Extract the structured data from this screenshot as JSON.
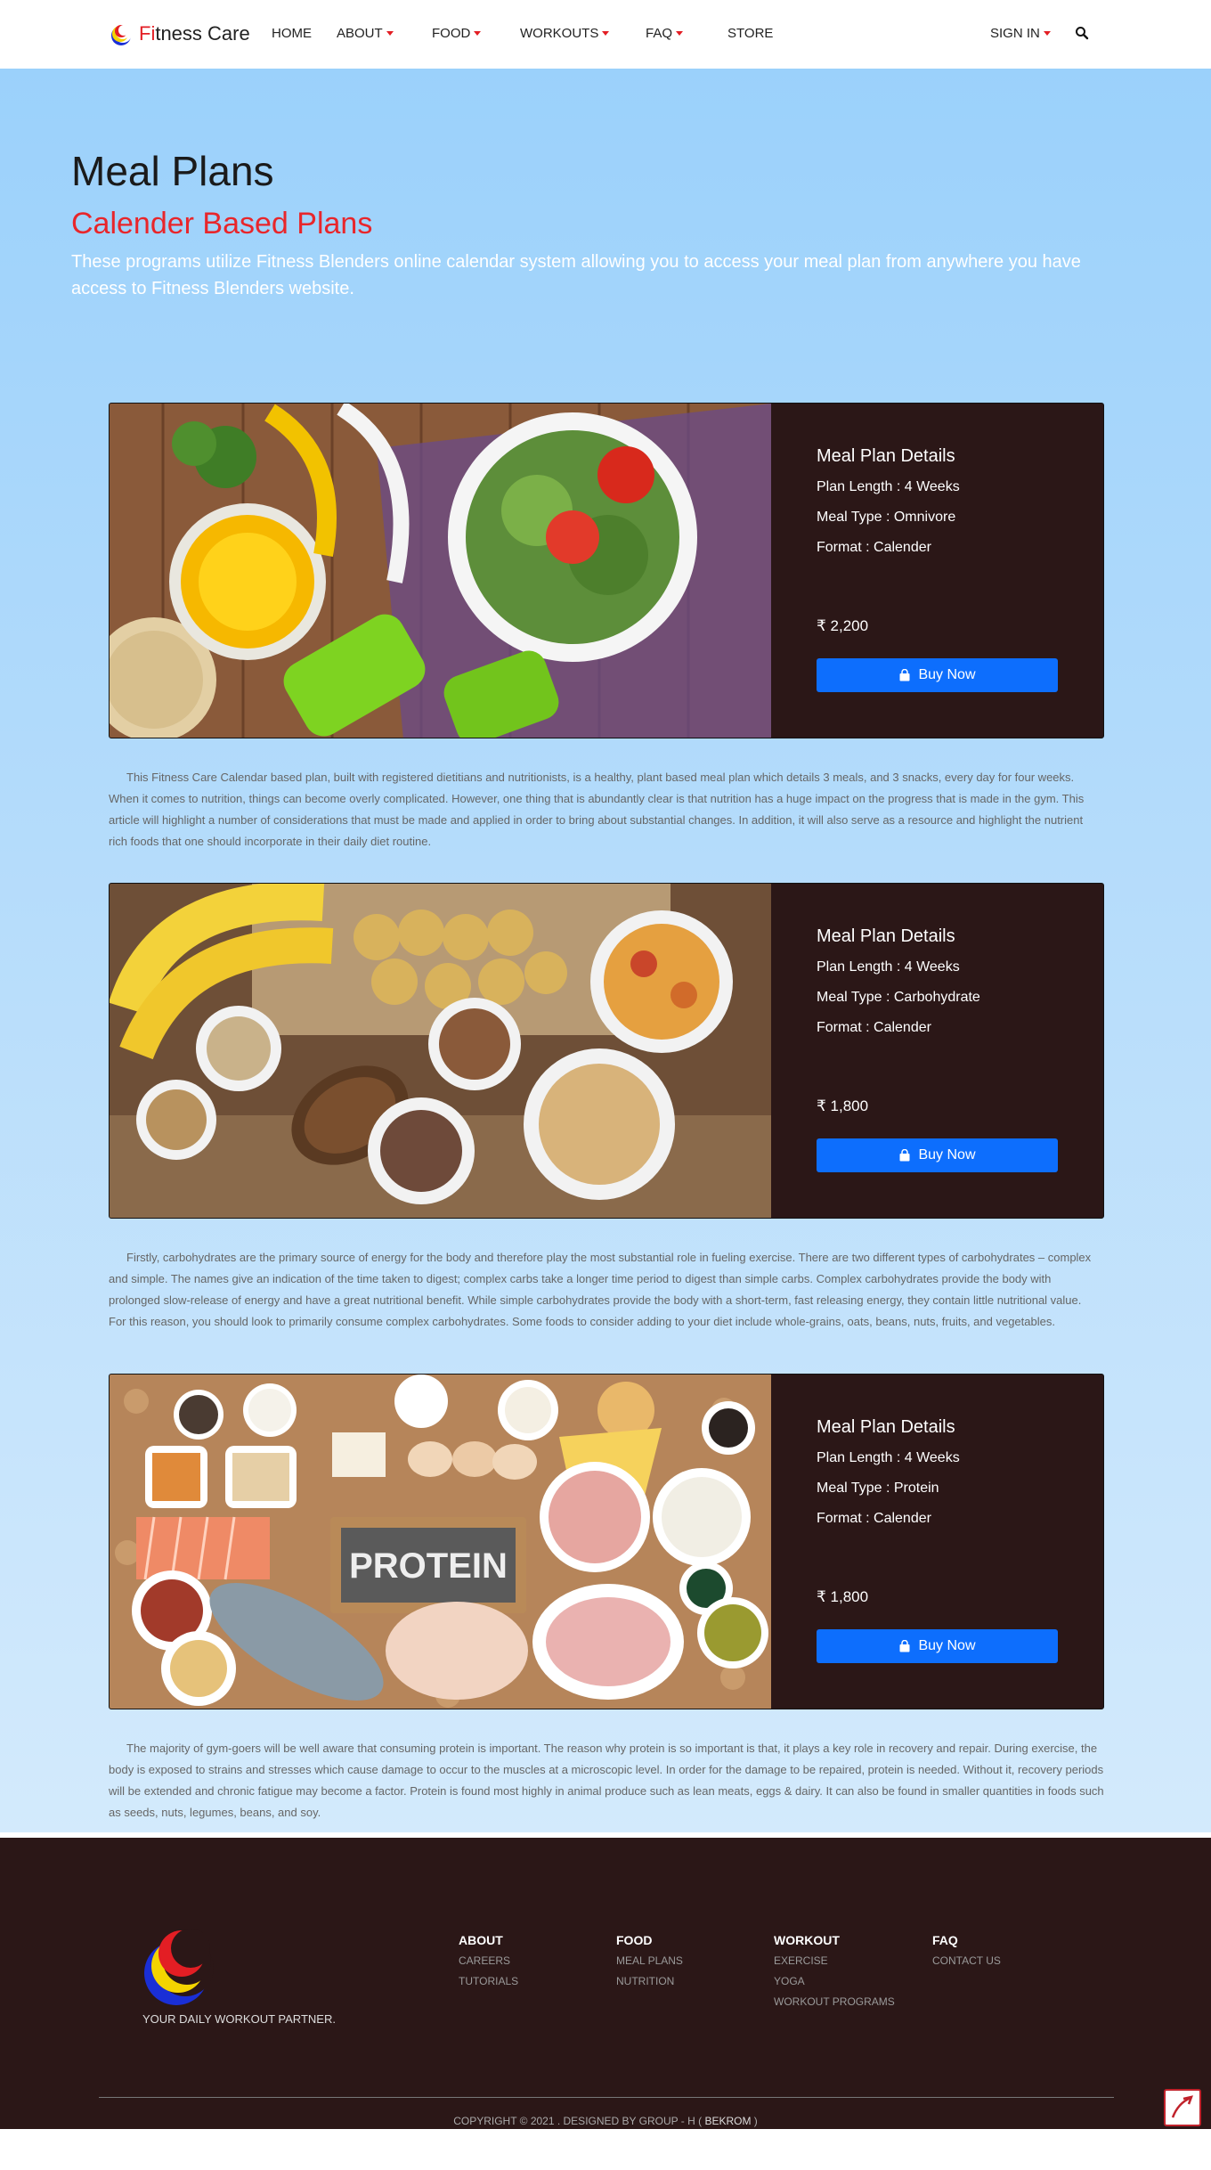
{
  "nav": {
    "brand_first_letters": "Fi",
    "brand_rest": "tness Care",
    "items": [
      {
        "label": "HOME",
        "dropdown": false
      },
      {
        "label": "ABOUT",
        "dropdown": true
      },
      {
        "label": "FOOD",
        "dropdown": true
      },
      {
        "label": "WORKOUTS",
        "dropdown": true
      },
      {
        "label": "FAQ",
        "dropdown": true
      },
      {
        "label": "STORE",
        "dropdown": false
      }
    ],
    "sign_in": "SIGN IN",
    "search_icon": "search-icon",
    "accent_color": "#e31e24"
  },
  "hero": {
    "title": "Meal Plans",
    "subtitle": "Calender Based Plans",
    "intro": "These programs utilize Fitness Blenders online calendar system allowing you to access your meal plan from anywhere you have access to Fitness Blenders website."
  },
  "plans": [
    {
      "details_title": "Meal Plan Details",
      "length": "Plan Length : 4 Weeks",
      "type": "Meal Type : Omnivore",
      "format": "Format : Calender",
      "price": "2,200",
      "button": "Buy Now",
      "description": [
        "This Fitness Care Calendar based plan, built with registered dietitians and nutritionists, is a healthy, plant based meal plan which details 3 meals, and 3 snacks, every day for four weeks. When it comes to nutrition, things can become overly complicated. However, one thing that is abundantly clear is that nutrition has a huge impact on the progress that is made in the gym. This article will highlight a number of considerations that must be made and applied in order to bring about substantial changes. In addition, it will also serve as a resource and highlight the nutrient rich foods that one should incorporate in their daily diet routine."
      ]
    },
    {
      "details_title": "Meal Plan Details",
      "length": "Plan Length : 4 Weeks",
      "type": "Meal Type : Carbohydrate",
      "format": "Format : Calender",
      "price": "1,800",
      "button": "Buy Now",
      "description": [
        "Firstly, carbohydrates are the primary source of energy for the body and therefore play the most substantial role in fueling exercise. There are two different types of carbohydrates – complex and simple. The names give an indication of the time taken to digest; complex carbs take a longer time period to digest than simple carbs. Complex carbohydrates provide the body with prolonged slow-release of energy and have a great nutritional benefit. While simple carbohydrates provide the body with a short-term, fast releasing energy, they contain little nutritional value.",
        "For this reason, you should look to primarily consume complex carbohydrates. Some foods to consider adding to your diet include whole-grains, oats, beans, nuts, fruits, and vegetables."
      ]
    },
    {
      "details_title": "Meal Plan Details",
      "length": "Plan Length : 4 Weeks",
      "type": "Meal Type : Protein",
      "format": "Format : Calender",
      "price": "1,800",
      "button": "Buy Now",
      "image_text": "PROTEIN",
      "description": [
        "The majority of gym-goers will be well aware that consuming protein is important. The reason why protein is so important is that, it plays a key role in recovery and repair. During exercise, the body is exposed to strains and stresses which cause damage to occur to the muscles at a microscopic level. In order for the damage to be repaired, protein is needed. Without it, recovery periods will be extended and chronic fatigue may become a factor. Protein is found most highly in animal produce such as lean meats, eggs & dairy. It can also be found in smaller quantities in foods such as seeds, nuts, legumes, beans, and soy."
      ]
    }
  ],
  "footer": {
    "tagline": "YOUR DAILY WORKOUT PARTNER.",
    "columns": [
      {
        "heading": "ABOUT",
        "links": [
          "CAREERS",
          "TUTORIALS"
        ]
      },
      {
        "heading": "FOOD",
        "links": [
          "MEAL PLANS",
          "NUTRITION"
        ]
      },
      {
        "heading": "WORKOUT",
        "links": [
          "EXERCISE",
          "YOGA",
          "WORKOUT PROGRAMS"
        ]
      },
      {
        "heading": "FAQ",
        "links": [
          "CONTACT US"
        ]
      }
    ],
    "copyright": "COPYRIGHT © 2021 . DESIGNED BY GROUP - H ( ",
    "copyright_name": "BEKROM",
    "copyright_end": " )"
  }
}
